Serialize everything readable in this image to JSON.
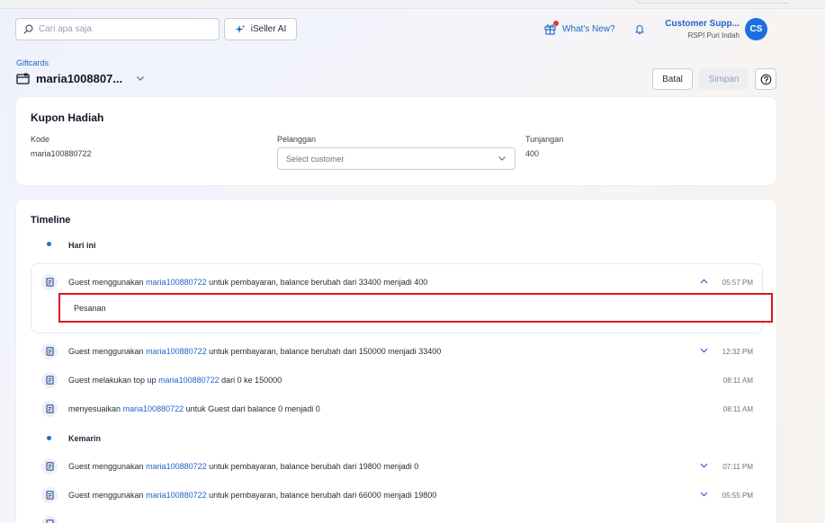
{
  "header": {
    "search_placeholder": "Cari apa saja",
    "ai_button": "iSeller AI",
    "whats_new": "What's New?",
    "user_name": "Customer Supp...",
    "user_location": "RSPI Puri Indah",
    "avatar_initials": "CS",
    "notification_dot_color": "#e53935"
  },
  "page": {
    "breadcrumb": "Giftcards",
    "title": "maria1008807...",
    "cancel_label": "Batal",
    "save_label": "Simpan",
    "help_icon": "question-circle-icon"
  },
  "coupon": {
    "heading": "Kupon Hadiah",
    "code_label": "Kode",
    "code_value": "maria100880722",
    "customer_label": "Pelanggan",
    "customer_placeholder": "Select customer",
    "allowance_label": "Tunjangan",
    "allowance_value": "400"
  },
  "timeline": {
    "heading": "Timeline",
    "days": [
      {
        "label": "Hari ini",
        "events": [
          {
            "prefix": "Guest menggunakan ",
            "link": "maria100880722",
            "suffix": " untuk pembayaran, balance berubah dari 33400 menjadi 400",
            "time": "05:57 PM",
            "expand": "up",
            "detail": "Pesanan"
          },
          {
            "prefix": "Guest menggunakan ",
            "link": "maria100880722",
            "suffix": " untuk pembayaran, balance berubah dari 150000 menjadi 33400",
            "time": "12:32 PM",
            "expand": "down"
          },
          {
            "prefix": "Guest melakukan top up ",
            "link": "maria100880722",
            "suffix": " dari 0 ke 150000",
            "time": "08:11 AM",
            "expand": "none"
          },
          {
            "prefix": "menyesuaikan ",
            "link": "maria100880722",
            "suffix": " untuk Guest dari balance 0 menjadi 0",
            "time": "08:11 AM",
            "expand": "none"
          }
        ]
      },
      {
        "label": "Kemarin",
        "events": [
          {
            "prefix": "Guest menggunakan ",
            "link": "maria100880722",
            "suffix": " untuk pembayaran, balance berubah dari 19800 menjadi 0",
            "time": "07:11 PM",
            "expand": "down"
          },
          {
            "prefix": "Guest menggunakan ",
            "link": "maria100880722",
            "suffix": " untuk pembayaran, balance berubah dari 66000 menjadi 19800",
            "time": "05:55 PM",
            "expand": "down"
          }
        ]
      }
    ]
  },
  "colors": {
    "accent": "#1d6fe0",
    "link": "#2563c9",
    "highlight_border": "#e0141b"
  }
}
